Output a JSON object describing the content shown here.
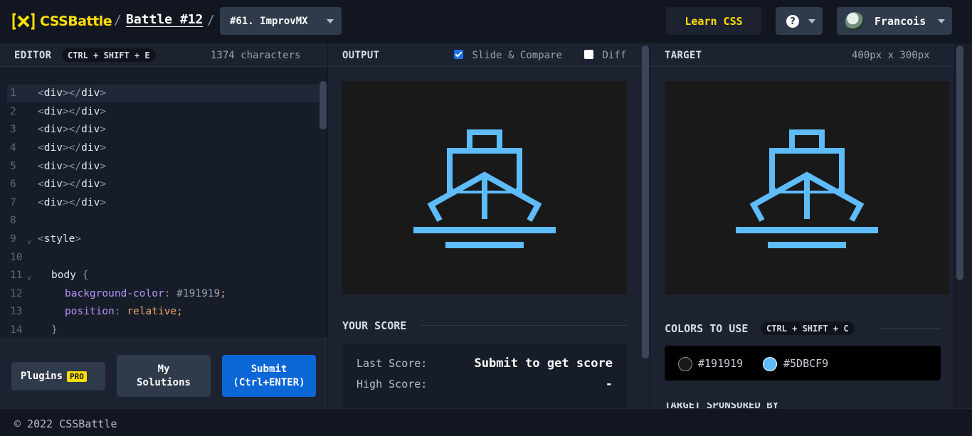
{
  "header": {
    "logo_text": "CSSBattle",
    "separator": "/",
    "battle_label": "Battle #12",
    "target_select": "#61. ImprovMX",
    "learn_label": "Learn CSS",
    "help_symbol": "?",
    "user_name": "Francois"
  },
  "editor": {
    "title": "EDITOR",
    "shortcut": "CTRL + SHIFT + E",
    "char_count": "1374 characters",
    "lines": [
      {
        "n": "1",
        "open": "div",
        "close": "div"
      },
      {
        "n": "2",
        "open": "div",
        "close": "div"
      },
      {
        "n": "3",
        "open": "div",
        "close": "div"
      },
      {
        "n": "4",
        "open": "div",
        "close": "div"
      },
      {
        "n": "5",
        "open": "div",
        "close": "div"
      },
      {
        "n": "6",
        "open": "div",
        "close": "div"
      },
      {
        "n": "7",
        "open": "div",
        "close": "div"
      },
      {
        "n": "8"
      },
      {
        "n": "9",
        "tag": "style"
      },
      {
        "n": "10"
      },
      {
        "n": "11",
        "selector": "body",
        "brace": "{"
      },
      {
        "n": "12",
        "prop": "background-color",
        "value": "#191919"
      },
      {
        "n": "13",
        "prop": "position",
        "value": "relative"
      },
      {
        "n": "14",
        "brace": "}"
      }
    ],
    "plugins_label": "Plugins",
    "pro_badge": "PRO",
    "solutions_line1": "My",
    "solutions_line2": "Solutions",
    "submit_line1": "Submit",
    "submit_line2": "(Ctrl+ENTER)"
  },
  "output": {
    "title": "OUTPUT",
    "slide_compare_label": "Slide & Compare",
    "slide_compare_checked": true,
    "diff_label": "Diff",
    "diff_checked": false,
    "score_title": "YOUR SCORE",
    "last_score_label": "Last Score:",
    "last_score_value": "Submit to get score",
    "high_score_label": "High Score:",
    "high_score_value": "-"
  },
  "target": {
    "title": "TARGET",
    "size": "400px x 300px",
    "colors_title": "COLORS TO USE",
    "colors_shortcut": "CTRL + SHIFT + C",
    "colors": [
      {
        "hex": "#191919",
        "label": "#191919"
      },
      {
        "hex": "#5DBCF9",
        "label": "#5DBCF9"
      }
    ],
    "sponsored_label": "TARGET SPONSORED BY"
  },
  "footer": {
    "copyright": "© 2022 CSSBattle"
  },
  "theme": {
    "accent_yellow": "#ffdf00",
    "submit_blue": "#0b66d6",
    "ship_blue": "#5DBCF9",
    "canvas_bg": "#191919"
  }
}
